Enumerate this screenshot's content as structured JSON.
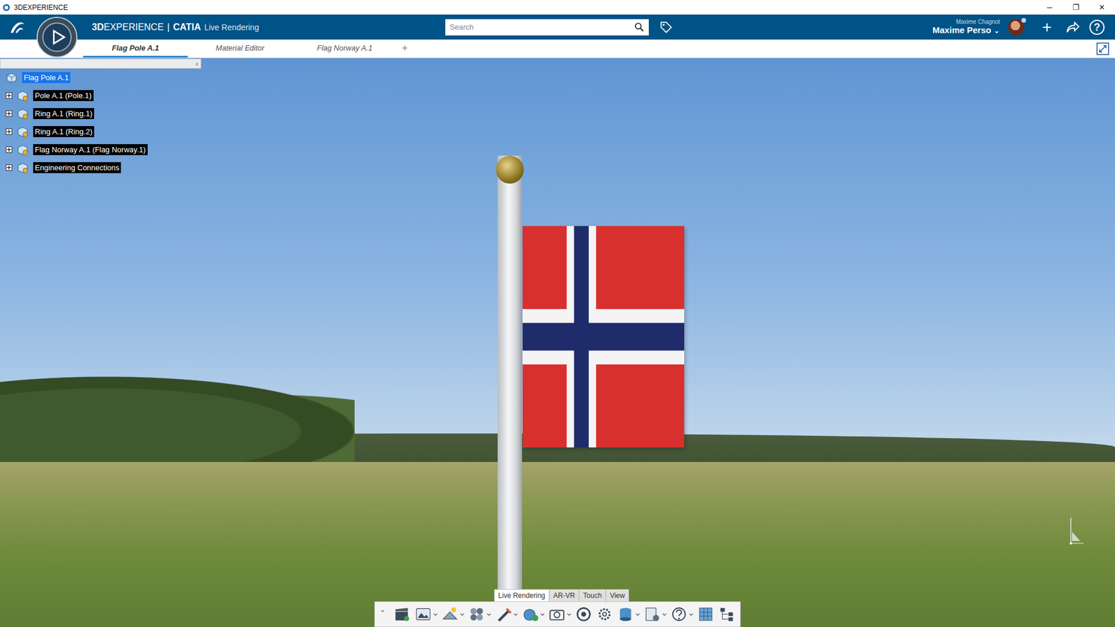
{
  "window": {
    "title": "3DEXPERIENCE",
    "controls": [
      "─",
      "❐",
      "✕"
    ]
  },
  "app_bar": {
    "brand_bold": "3D",
    "brand_rest": "EXPERIENCE",
    "separator": "|",
    "app": "CATIA",
    "role": "Live Rendering",
    "search": {
      "placeholder": "Search"
    },
    "user": {
      "name": "Maxime Chagnot",
      "space": "Maxime Perso",
      "caret": "⌄"
    },
    "actions": [
      "+",
      "?"
    ]
  },
  "tabs": [
    {
      "label": "Flag Pole A.1",
      "selected": true
    },
    {
      "label": "Material Editor",
      "selected": false
    },
    {
      "label": "Flag Norway A.1",
      "selected": false
    }
  ],
  "new_tab": "+",
  "tree": {
    "collapse": "‹",
    "root": {
      "label": "Flag Pole A.1",
      "selected": true
    },
    "items": [
      {
        "label": "Pole A.1 (Pole.1)",
        "expanded": false
      },
      {
        "label": "Ring A.1 (Ring.1)",
        "expanded": false
      },
      {
        "label": "Ring A.1 (Ring.2)",
        "expanded": false
      },
      {
        "label": "Flag Norway A.1 (Flag Norway.1)",
        "expanded": false
      },
      {
        "label": "Engineering Connections",
        "expanded": false
      }
    ]
  },
  "toolbar": {
    "collapse": "⌄",
    "tabs": [
      {
        "label": "Live Rendering",
        "selected": true
      },
      {
        "label": "AR-VR",
        "selected": false
      },
      {
        "label": "Touch",
        "selected": false
      },
      {
        "label": "View",
        "selected": false
      }
    ]
  }
}
